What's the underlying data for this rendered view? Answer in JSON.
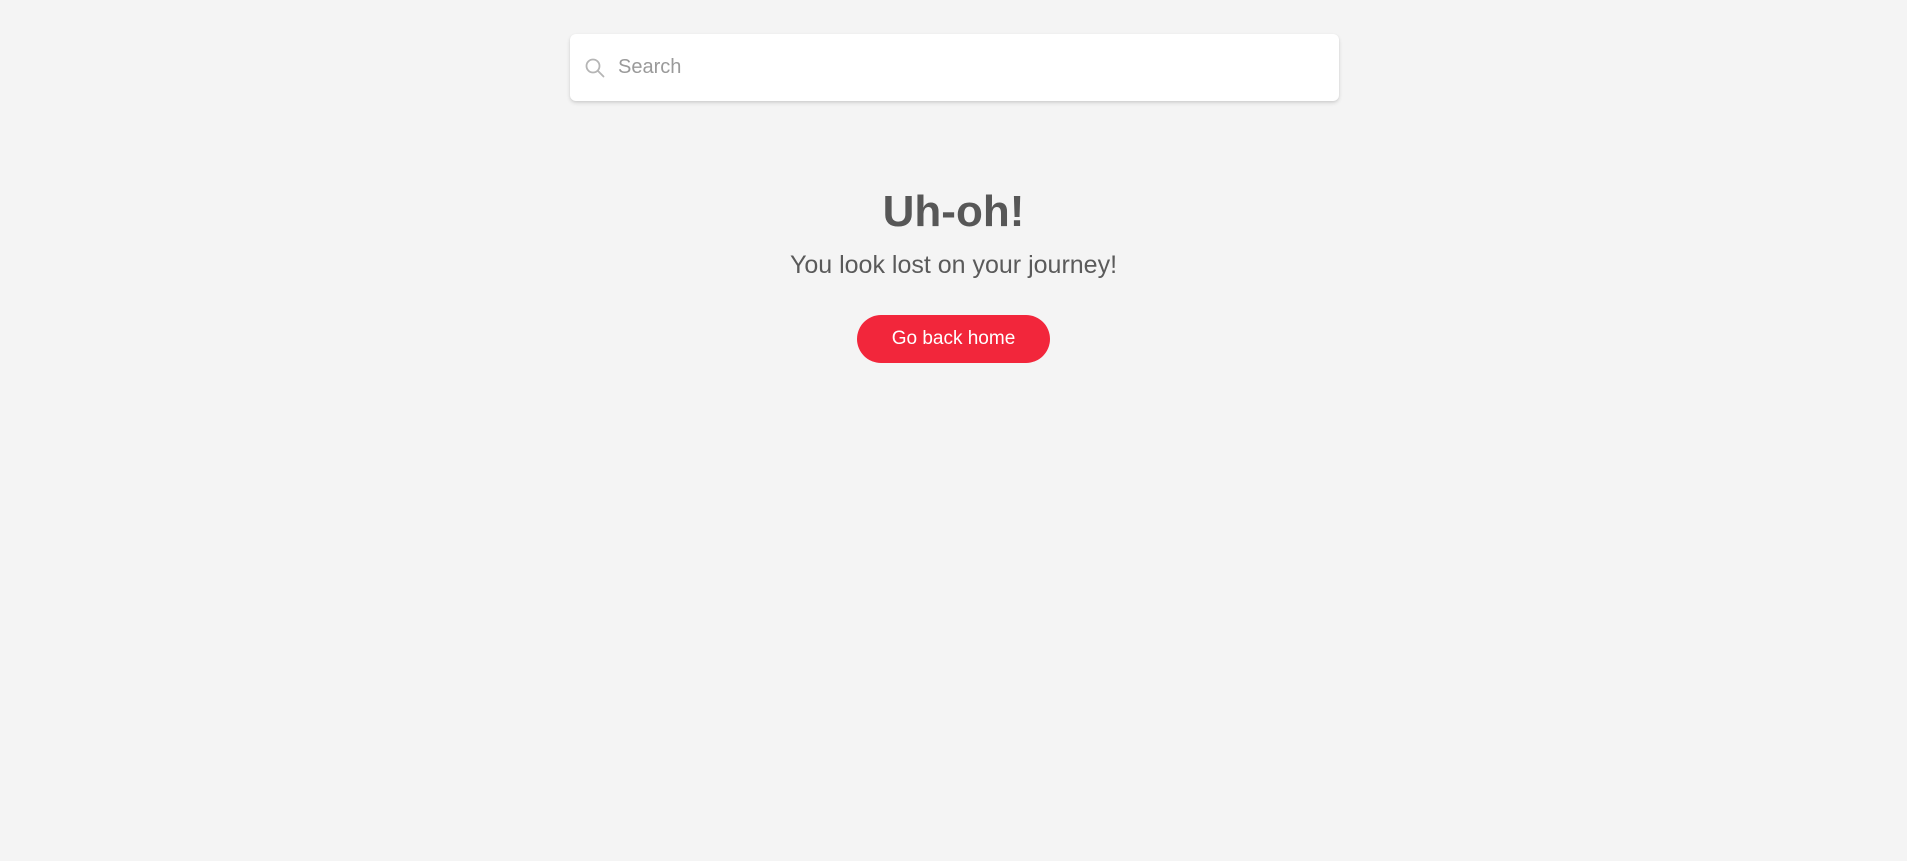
{
  "search": {
    "placeholder": "Search",
    "value": "",
    "icon": "search-icon"
  },
  "error": {
    "title": "Uh-oh!",
    "message": "You look lost on your journey!"
  },
  "actions": {
    "home_label": "Go back home"
  },
  "colors": {
    "background": "#f4f4f4",
    "accent": "#f2263b",
    "text": "#575757"
  }
}
